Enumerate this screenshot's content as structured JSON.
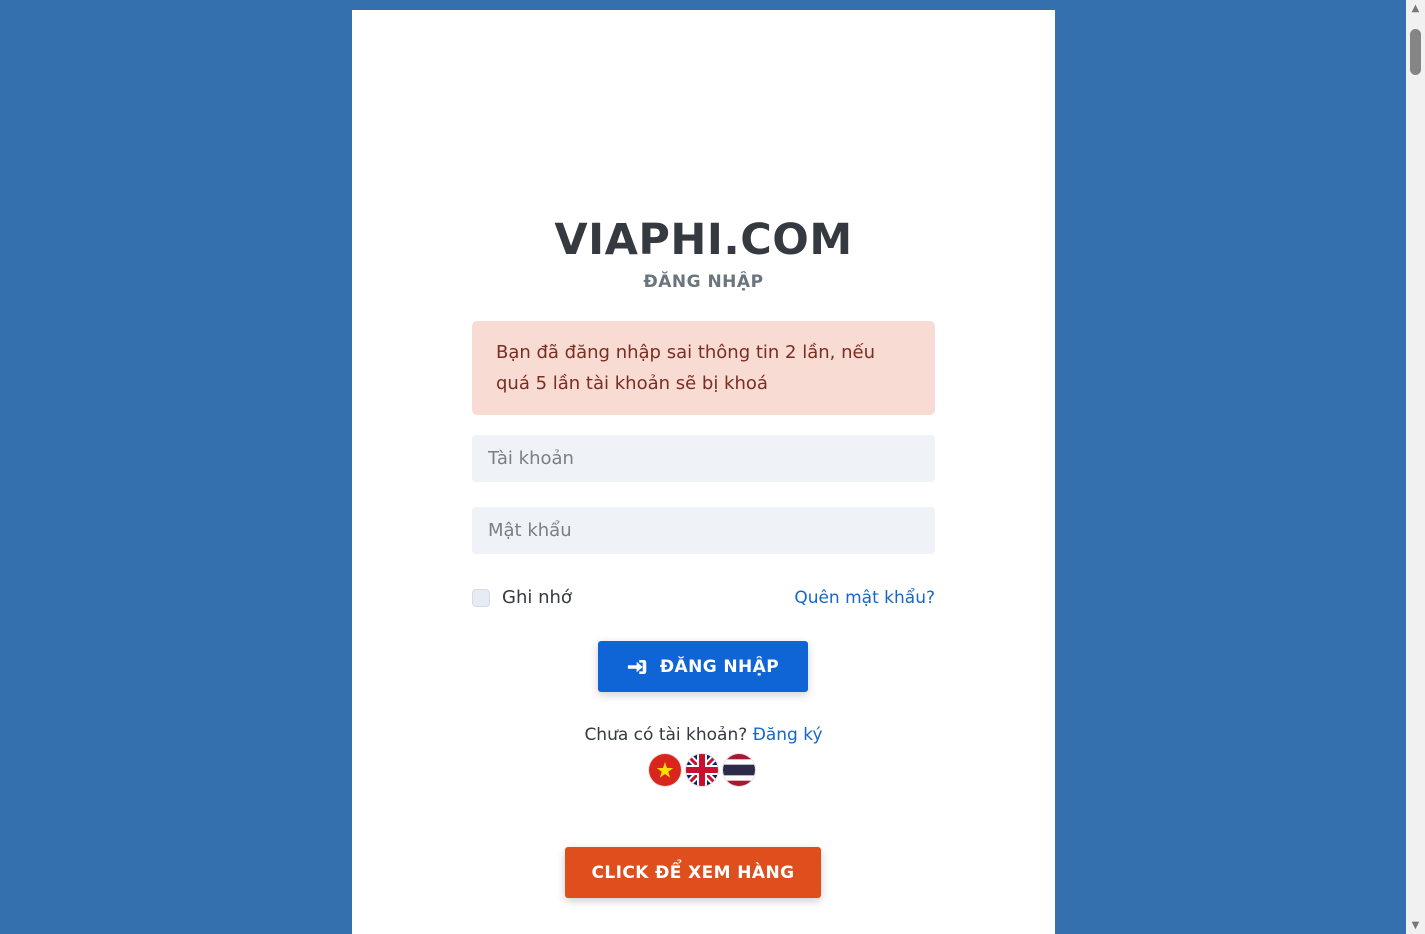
{
  "brand": "VIAPHI.COM",
  "page_heading": "ĐĂNG NHẬP",
  "alert_message": "Bạn đã đăng nhập sai thông tin 2 lần, nếu quá 5 lần tài khoản sẽ bị khoá",
  "form": {
    "username_placeholder": "Tài khoản",
    "username_value": "",
    "password_placeholder": "Mật khẩu",
    "password_value": "",
    "remember_label": "Ghi nhớ",
    "remember_checked": false,
    "forgot_password": "Quên mật khẩu?",
    "login_button": "ĐĂNG NHẬP"
  },
  "register": {
    "prompt": "Chưa có tài khoản?",
    "link": "Đăng ký"
  },
  "languages": [
    {
      "code": "vi",
      "icon": "vietnam-flag-icon"
    },
    {
      "code": "en",
      "icon": "united-kingdom-flag-icon"
    },
    {
      "code": "th",
      "icon": "thailand-flag-icon"
    }
  ],
  "products_button": "CLICK ĐỂ XEM HÀNG",
  "colors": {
    "background": "#3470ae",
    "alert_background": "#f8dcd4",
    "primary": "#0f64d6",
    "accent": "#df4f1d"
  }
}
